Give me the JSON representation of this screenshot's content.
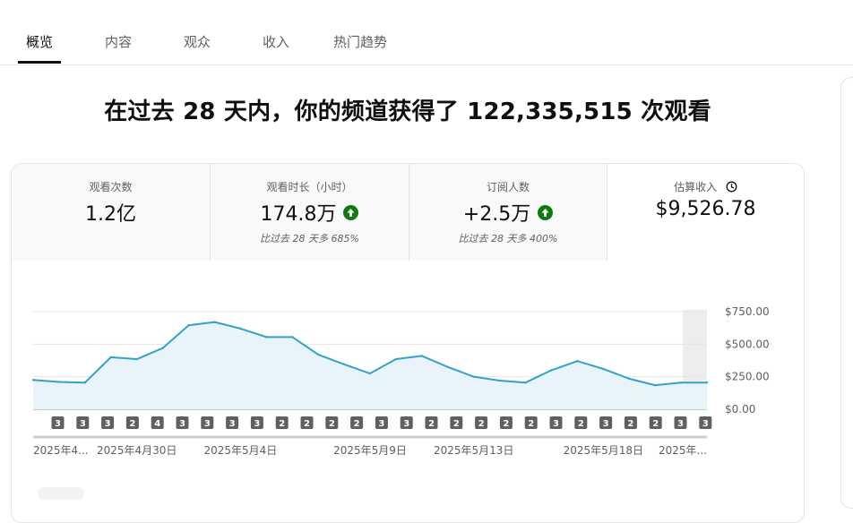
{
  "tabs": [
    {
      "label": "概览"
    },
    {
      "label": "内容"
    },
    {
      "label": "观众"
    },
    {
      "label": "收入"
    },
    {
      "label": "热门趋势"
    }
  ],
  "headline": "在过去 28 天内，你的频道获得了 122,335,515 次观看",
  "metrics": [
    {
      "label": "观看次数",
      "value": "1.2亿"
    },
    {
      "label": "观看时长（小时）",
      "value": "174.8万",
      "trend": "up",
      "note": "比过去 28 天多 685%"
    },
    {
      "label": "订阅人数",
      "value": "+2.5万",
      "trend": "up",
      "note": "比过去 28 天多 400%"
    },
    {
      "label": "估算收入",
      "value": "$9,526.78",
      "icon": "clock-icon"
    }
  ],
  "colors": {
    "line": "#33a1c9",
    "fill": "#e8f4fa",
    "trend_up": "#0f7b0f",
    "badge": "#606060"
  },
  "chart_data": {
    "type": "area",
    "metric": "估算收入",
    "x": [
      "2025-04-26",
      "2025-04-27",
      "2025-04-28",
      "2025-04-29",
      "2025-04-30",
      "2025-05-01",
      "2025-05-02",
      "2025-05-03",
      "2025-05-04",
      "2025-05-05",
      "2025-05-06",
      "2025-05-07",
      "2025-05-08",
      "2025-05-09",
      "2025-05-10",
      "2025-05-11",
      "2025-05-12",
      "2025-05-13",
      "2025-05-14",
      "2025-05-15",
      "2025-05-16",
      "2025-05-17",
      "2025-05-18",
      "2025-05-19",
      "2025-05-20",
      "2025-05-21",
      "2025-05-22"
    ],
    "values": [
      225,
      210,
      205,
      400,
      385,
      470,
      645,
      670,
      620,
      555,
      555,
      420,
      345,
      275,
      385,
      410,
      325,
      250,
      220,
      205,
      300,
      370,
      310,
      235,
      185,
      205,
      205
    ],
    "y_ticks": [
      "$0.00",
      "$250.00",
      "$500.00",
      "$750.00"
    ],
    "y_tick_values": [
      0,
      250,
      500,
      750
    ],
    "ylim": [
      0,
      750
    ],
    "x_tick_labels": [
      {
        "index": 0,
        "label": "2025年4..."
      },
      {
        "index": 4,
        "label": "2025年4月30日"
      },
      {
        "index": 8,
        "label": "2025年5月4日"
      },
      {
        "index": 13,
        "label": "2025年5月9日"
      },
      {
        "index": 17,
        "label": "2025年5月13日"
      },
      {
        "index": 22,
        "label": "2025年5月18日"
      },
      {
        "index": 26,
        "label": "2025年..."
      }
    ],
    "badges": [
      "3",
      "3",
      "3",
      "2",
      "4",
      "3",
      "3",
      "3",
      "3",
      "2",
      "2",
      "2",
      "2",
      "3",
      "3",
      "2",
      "2",
      "2",
      "2",
      "2",
      "3",
      "2",
      "3",
      "2",
      "2",
      "3",
      "3"
    ],
    "grid": true
  }
}
